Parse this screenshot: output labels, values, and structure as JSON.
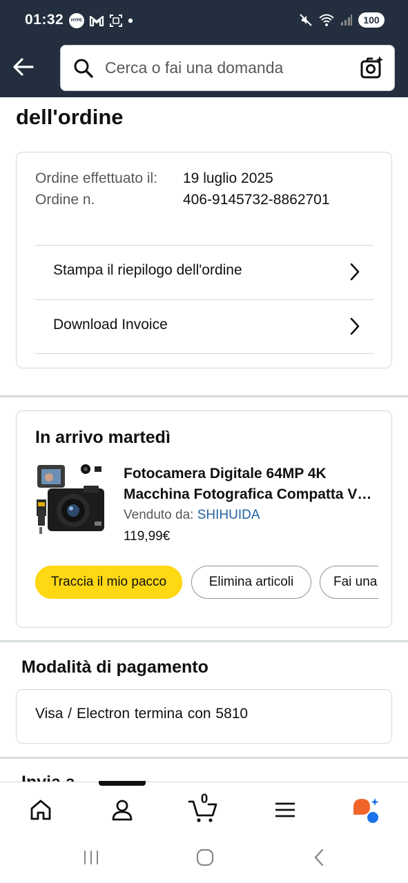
{
  "status_bar": {
    "time": "01:32",
    "hype_badge": "HYPE",
    "battery": "100"
  },
  "search": {
    "placeholder": "Cerca o fai una domanda"
  },
  "page": {
    "title": "dell'ordine"
  },
  "order_info": {
    "date_label": "Ordine effettuato il:",
    "number_label": "Ordine n.",
    "date_value": "19 luglio 2025",
    "number_value": "406-9145732-8862701",
    "print_summary_label": "Stampa il riepilogo dell'ordine",
    "download_invoice_label": "Download Invoice"
  },
  "shipment": {
    "arrival": "In arrivo martedì",
    "product_title_line1": "Fotocamera Digitale 64MP 4K",
    "product_title_line2": "Macchina Fotografica Compatta Vlogging",
    "sold_by_label": "Venduto da:",
    "seller": "SHIHUIDA",
    "price": "119,99€",
    "track_button": "Traccia il mio pacco",
    "delete_button": "Elimina articoli",
    "more_button": "Fai una domanda"
  },
  "payment": {
    "title": "Modalità di pagamento",
    "method": "Visa / Electron  termina con 5810"
  },
  "shipping": {
    "title": "Invia a"
  },
  "bottom_nav": {
    "cart_count": "0",
    "accent_orange": "#f0642a",
    "accent_blue": "#1a73e8"
  },
  "colors": {
    "header_bg": "#232f3e",
    "primary_button": "#ffd814",
    "link": "#2162a1"
  }
}
